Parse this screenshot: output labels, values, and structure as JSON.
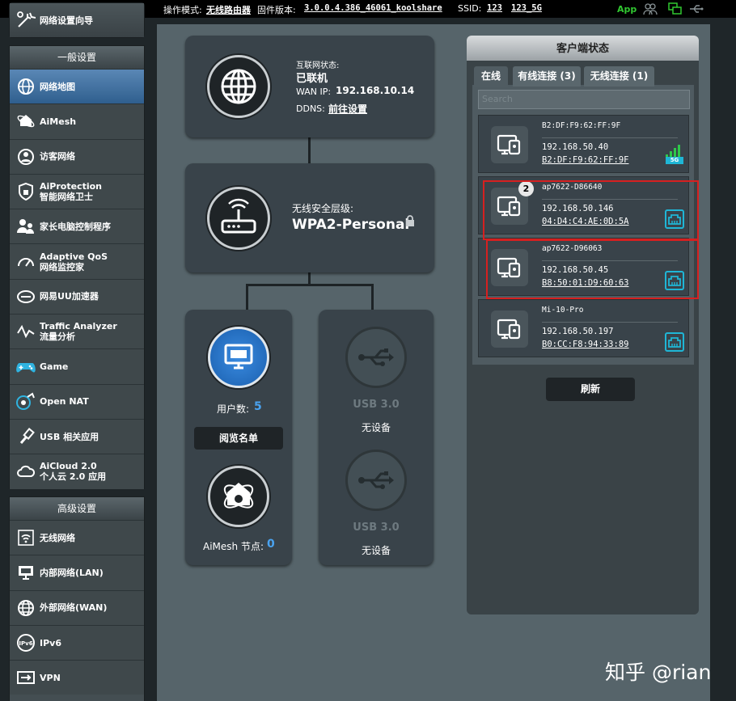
{
  "topbar": {
    "mode_label": "操作模式:",
    "mode_value": "无线路由器",
    "firmware_label": "固件版本:",
    "firmware_value": "3.0.0.4.386_46061_koolshare",
    "ssid_label": "SSID:",
    "ssid_1": "123",
    "ssid_2": "123_5G",
    "app_label": "App"
  },
  "sidebar": {
    "wizard": "网络设置向导",
    "general_header": "一般设置",
    "general_items": [
      {
        "label": "网络地图",
        "icon": "globe-icon"
      },
      {
        "label": "AiMesh",
        "icon": "aimesh-icon"
      },
      {
        "label": "访客网络",
        "icon": "guest-network-icon"
      },
      {
        "label": "AiProtection",
        "label2": "智能网络卫士",
        "icon": "shield-icon"
      },
      {
        "label": "家长电脑控制程序",
        "icon": "parental-icon"
      },
      {
        "label": "Adaptive QoS",
        "label2": "网络监控家",
        "icon": "gauge-icon"
      },
      {
        "label": "网易UU加速器",
        "icon": "uu-icon"
      },
      {
        "label": "Traffic Analyzer",
        "label2": "流量分析",
        "icon": "traffic-icon"
      },
      {
        "label": "Game",
        "icon": "gamepad-icon"
      },
      {
        "label": "Open NAT",
        "icon": "open-nat-icon"
      },
      {
        "label": "USB 相关应用",
        "icon": "usb-icon"
      },
      {
        "label": "AiCloud 2.0",
        "label2": "个人云 2.0 应用",
        "icon": "cloud-icon"
      }
    ],
    "advanced_header": "高级设置",
    "advanced_items": [
      {
        "label": "无线网络",
        "icon": "wifi-icon"
      },
      {
        "label": "内部网络(LAN)",
        "icon": "lan-icon"
      },
      {
        "label": "外部网络(WAN)",
        "icon": "wan-icon"
      },
      {
        "label": "IPv6",
        "icon": "ipv6-icon"
      },
      {
        "label": "VPN",
        "icon": "vpn-icon"
      }
    ]
  },
  "map": {
    "internet_status_label": "互联网状态:",
    "internet_status": "已联机",
    "wan_ip_label": "WAN IP:",
    "wan_ip": "192.168.10.14",
    "ddns_label": "DDNS:",
    "ddns_link": "前往设置",
    "security_label": "无线安全层级:",
    "security_value": "WPA2-Personal",
    "clients_label": "用户数:",
    "clients_count": "5",
    "view_list_button": "阅览名单",
    "aimesh_label": "AiMesh 节点:",
    "aimesh_count": "0",
    "usb1_label": "USB 3.0",
    "usb1_status": "无设备",
    "usb2_label": "USB 3.0",
    "usb2_status": "无设备"
  },
  "client_panel": {
    "title": "客户端状态",
    "tabs": [
      "在线",
      "有线连接 (3)",
      "无线连接 (1)"
    ],
    "search_placeholder": "Search",
    "clients": [
      {
        "name": "B2:DF:F9:62:FF:9F",
        "ip": "192.168.50.40",
        "mac": "B2:DF:F9:62:FF:9F",
        "connection": "wifi-5g"
      },
      {
        "name": "ap7622-D86640",
        "ip": "192.168.50.146",
        "mac": "04:D4:C4:AE:0D:5A",
        "connection": "ethernet"
      },
      {
        "name": "ap7622-D96063",
        "ip": "192.168.50.45",
        "mac": "B8:50:01:D9:60:63",
        "connection": "ethernet"
      },
      {
        "name": "Mi-10-Pro",
        "ip": "192.168.50.197",
        "mac": "B0:CC:F8:94:33:89",
        "connection": "ethernet"
      }
    ],
    "badge": "2",
    "wifi_band": "5G",
    "refresh_button": "刷新"
  },
  "watermark": "知乎 @rian",
  "colors": {
    "accent_blue": "#3a8be0",
    "cyan": "#1fb6d6",
    "highlight_red": "#d62020",
    "app_green": "#31c831"
  }
}
